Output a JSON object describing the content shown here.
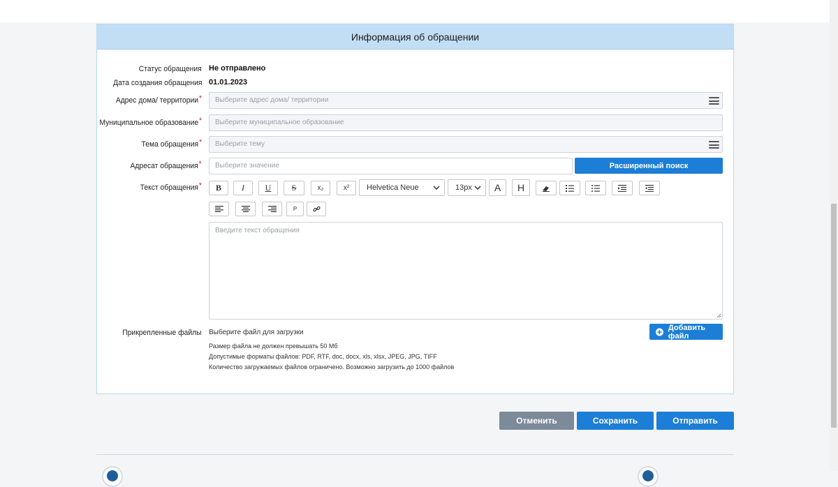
{
  "panel": {
    "title": "Информация об обращении"
  },
  "form": {
    "status_label": "Статус обращения",
    "status_value": "Не отправлено",
    "date_label": "Дата создания обращения",
    "date_value": "01.01.2023",
    "address_label": "Адрес дома/ территории",
    "address_placeholder": "Выберите адрес дома/ территории",
    "municipality_label": "Муниципальное образование",
    "municipality_placeholder": "Выберите муниципальное образование",
    "topic_label": "Тема обращения",
    "topic_placeholder": "Выберите тему",
    "addressee_label": "Адресат обращения",
    "addressee_placeholder": "Выберите значение",
    "advanced_search_label": "Расширенный поиск",
    "text_label": "Текст обращения",
    "text_placeholder": "Введите текст обращения",
    "required_mark": "*"
  },
  "editor": {
    "bold": "B",
    "italic": "I",
    "underline": "U",
    "strike": "S",
    "subscript": "x₂",
    "superscript": "x²",
    "font_family": "Helvetica Neue",
    "font_size": "13px",
    "font_color": "A",
    "highlight": "H",
    "paragraph": "P"
  },
  "files": {
    "label": "Прикрепленные файлы",
    "choose_text": "Выберите файл для загрузки",
    "add_button": "Добавить файл",
    "size_note": "Размер файла не должен превышать 50 Мб",
    "formats_note": "Допустимые форматы файлов: PDF, RTF, doc, docx, xls, xlsx, JPEG, JPG, TIFF",
    "count_note": "Количество загружаемых файлов ограничено. Возможно загрузить до 1000 файлов"
  },
  "actions": {
    "cancel": "Отменить",
    "save": "Сохранить",
    "send": "Отправить"
  },
  "colors": {
    "primary": "#1c7ed6",
    "cancel": "#7c8a99",
    "header_bg": "#c2def4",
    "required": "#c0282d"
  }
}
